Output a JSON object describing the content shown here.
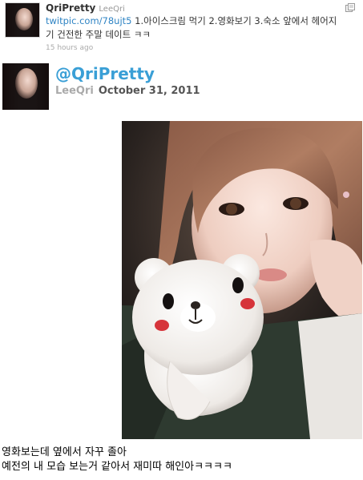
{
  "tweet": {
    "display_name": "QriPretty",
    "username": "LeeQri",
    "link": "twitpic.com/78ujt5",
    "text": " 1.아이스크림 먹기 2.영화보기 3.숙소 앞에서 헤어지기 건전한 주말 데이트 ㅋㅋ",
    "time": "15 hours ago",
    "corner_icon": "retweet-icon"
  },
  "post": {
    "handle": "@QriPretty",
    "author": "LeeQri",
    "date": "October 31, 2011"
  },
  "photo": {
    "bear_cheek_color": "#d6343a"
  },
  "caption": {
    "line1": "영화보는데 옆에서 자꾸 졸아",
    "line2": "예전의 내 모습 보는거 같아서 재미따 해인아ㅋㅋㅋㅋ"
  },
  "colors": {
    "link": "#2f84c4",
    "handle_accent": "#3a9fd6"
  }
}
